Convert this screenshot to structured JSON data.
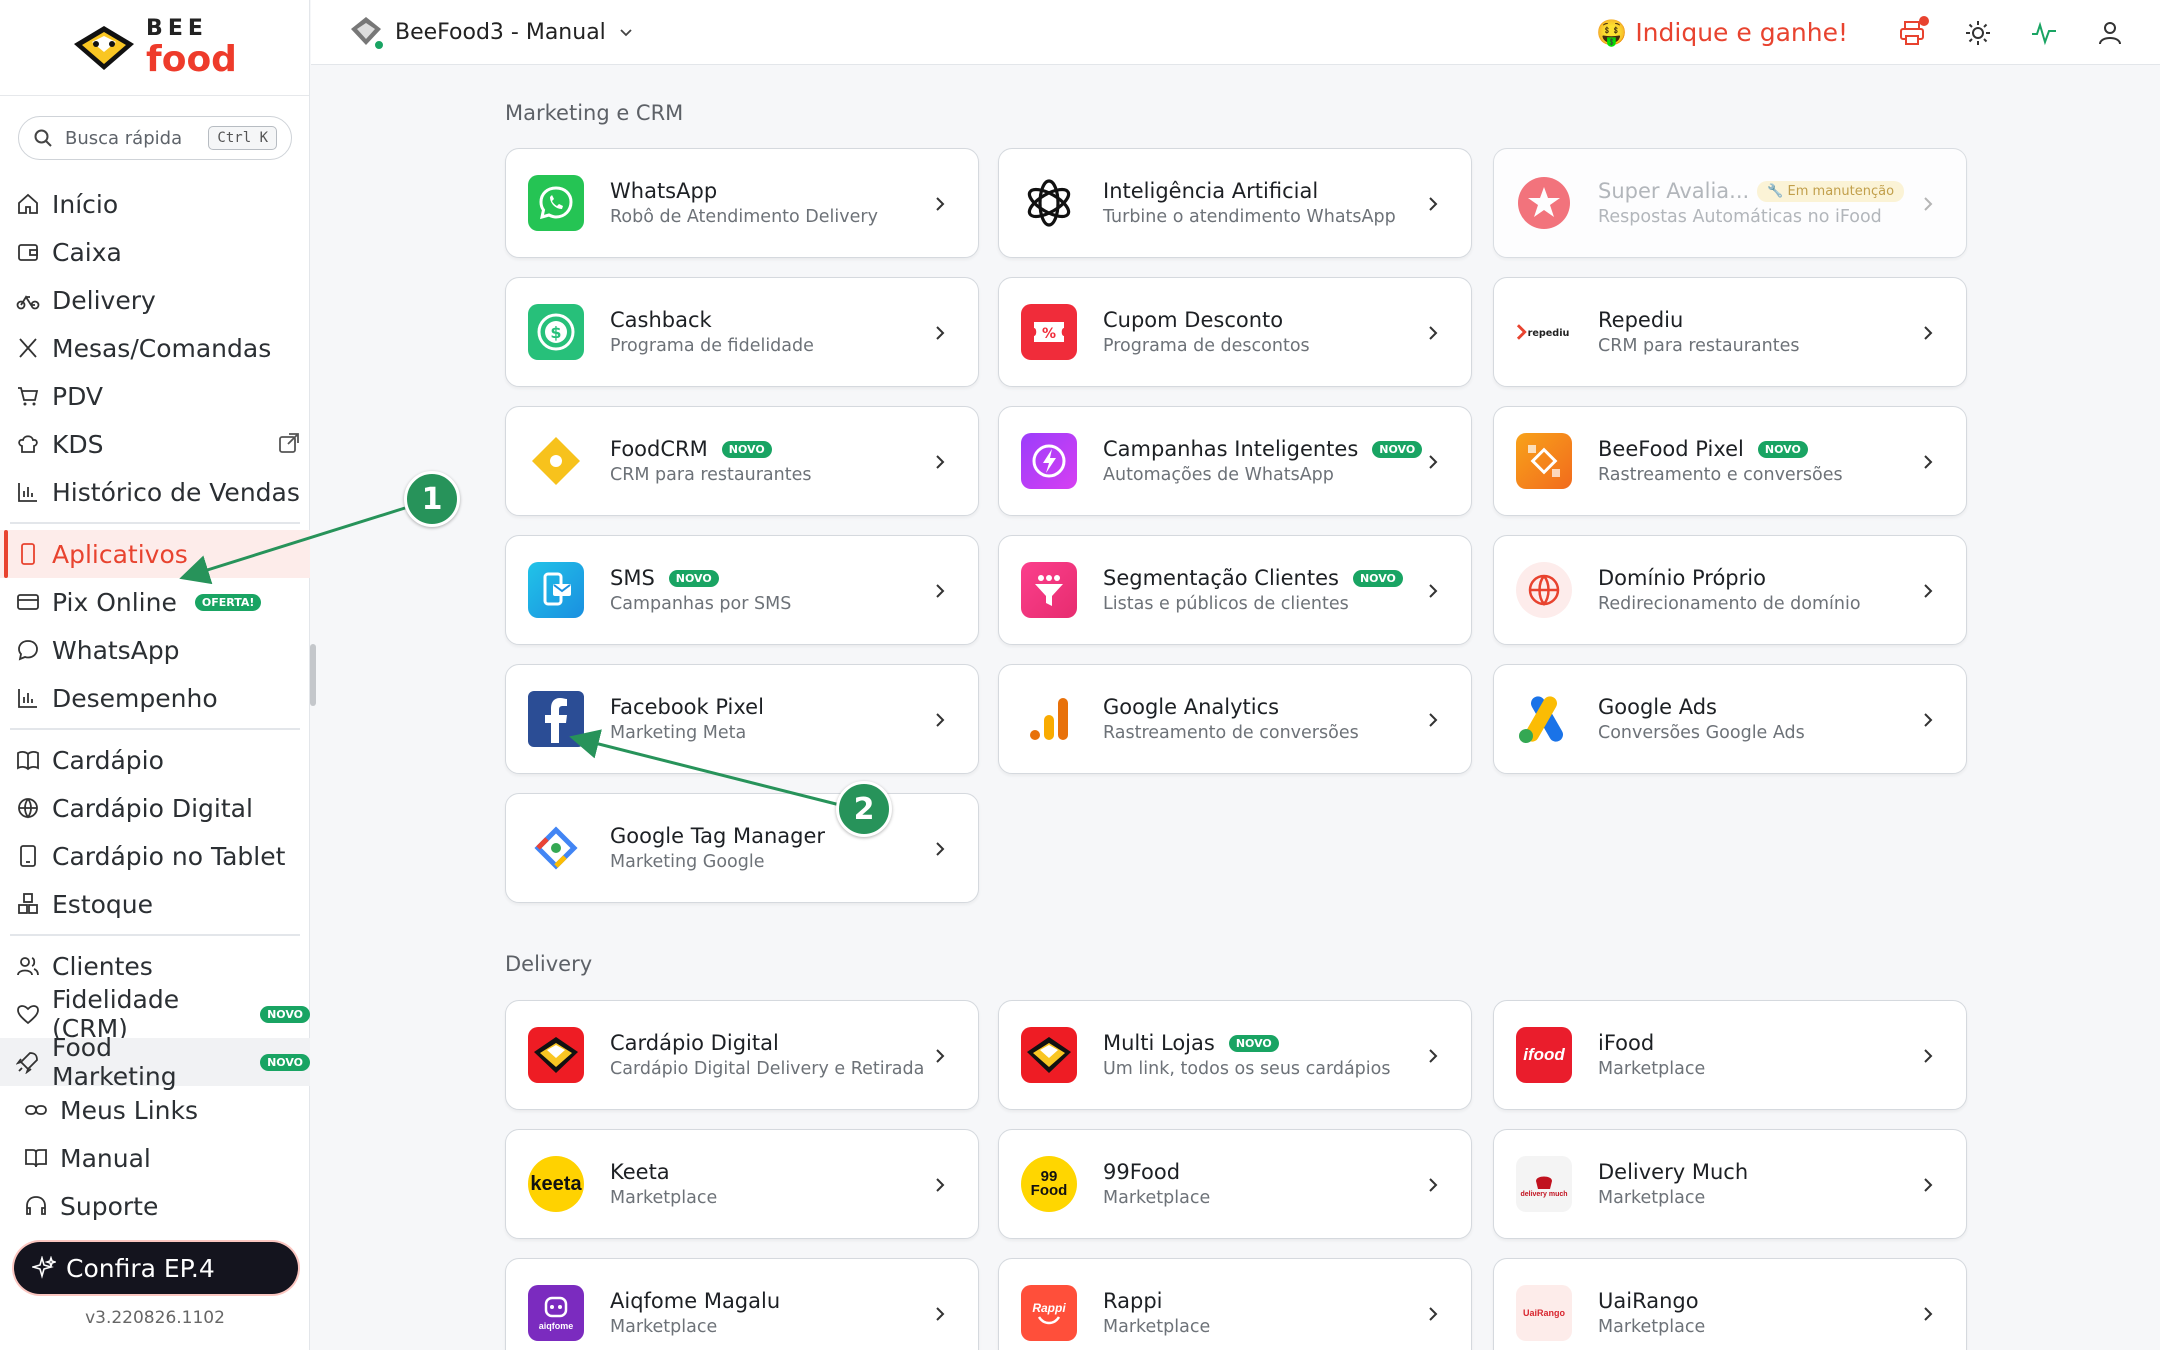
{
  "brand": {
    "top": "BEE",
    "bottom": "food"
  },
  "search": {
    "placeholder": "Busca rápida",
    "shortcut": "Ctrl K"
  },
  "sidebar": {
    "items": [
      {
        "label": "Início",
        "icon": "home-icon"
      },
      {
        "label": "Caixa",
        "icon": "wallet-icon"
      },
      {
        "label": "Delivery",
        "icon": "bike-icon"
      },
      {
        "label": "Mesas/Comandas",
        "icon": "utensils-icon"
      },
      {
        "label": "PDV",
        "icon": "cart-icon"
      },
      {
        "label": "KDS",
        "icon": "chef-hat-icon"
      },
      {
        "label": "Histórico de Vendas",
        "icon": "bar-chart-icon"
      },
      {
        "label": "Aplicativos",
        "icon": "phone-icon"
      },
      {
        "label": "Pix Online",
        "icon": "card-icon",
        "badge": "OFERTA!"
      },
      {
        "label": "WhatsApp",
        "icon": "chat-icon"
      },
      {
        "label": "Desempenho",
        "icon": "stats-icon"
      },
      {
        "label": "Cardápio",
        "icon": "book-icon"
      },
      {
        "label": "Cardápio Digital",
        "icon": "globe-icon"
      },
      {
        "label": "Cardápio no Tablet",
        "icon": "tablet-icon"
      },
      {
        "label": "Estoque",
        "icon": "boxes-icon"
      },
      {
        "label": "Clientes",
        "icon": "users-icon"
      },
      {
        "label": "Fidelidade (CRM)",
        "icon": "heart-icon",
        "badge": "NOVO"
      },
      {
        "label": "Food Marketing",
        "icon": "rocket-icon",
        "badge": "NOVO"
      },
      {
        "label": "Meus Links",
        "icon": "link-icon"
      },
      {
        "label": "Manual",
        "icon": "manual-icon"
      },
      {
        "label": "Suporte",
        "icon": "headset-icon"
      }
    ],
    "cta": "Confira EP.4",
    "version": "v3.220826.1102"
  },
  "header": {
    "store": "BeeFood3 - Manual",
    "refer": "Indique e ganhe!",
    "refer_emoji": "🤑"
  },
  "sections": {
    "marketing": {
      "title": "Marketing e CRM",
      "cards": [
        {
          "title": "WhatsApp",
          "sub": "Robô de Atendimento Delivery"
        },
        {
          "title": "Inteligência Artificial",
          "sub": "Turbine o atendimento WhatsApp"
        },
        {
          "title": "Super Avalia...",
          "sub": "Respostas Automáticas no iFood",
          "badge": "🔧 Em manutenção"
        },
        {
          "title": "Cashback",
          "sub": "Programa de fidelidade"
        },
        {
          "title": "Cupom Desconto",
          "sub": "Programa de descontos"
        },
        {
          "title": "Repediu",
          "sub": "CRM para restaurantes",
          "logo": "repediu"
        },
        {
          "title": "FoodCRM",
          "sub": "CRM para restaurantes",
          "badge": "NOVO"
        },
        {
          "title": "Campanhas Inteligentes",
          "sub": "Automações de WhatsApp",
          "badge": "NOVO"
        },
        {
          "title": "BeeFood Pixel",
          "sub": "Rastreamento e conversões",
          "badge": "NOVO"
        },
        {
          "title": "SMS",
          "sub": "Campanhas por SMS",
          "badge": "NOVO"
        },
        {
          "title": "Segmentação Clientes",
          "sub": "Listas e públicos de clientes",
          "badge": "NOVO"
        },
        {
          "title": "Domínio Próprio",
          "sub": "Redirecionamento de domínio"
        },
        {
          "title": "Facebook Pixel",
          "sub": "Marketing Meta"
        },
        {
          "title": "Google Analytics",
          "sub": "Rastreamento de conversões"
        },
        {
          "title": "Google Ads",
          "sub": "Conversões Google Ads"
        },
        {
          "title": "Google Tag Manager",
          "sub": "Marketing Google"
        }
      ]
    },
    "delivery": {
      "title": "Delivery",
      "cards": [
        {
          "title": "Cardápio Digital",
          "sub": "Cardápio Digital Delivery e Retirada"
        },
        {
          "title": "Multi Lojas",
          "sub": "Um link, todos os seus cardápios",
          "badge": "NOVO"
        },
        {
          "title": "iFood",
          "sub": "Marketplace",
          "logo": "ifood"
        },
        {
          "title": "Keeta",
          "sub": "Marketplace",
          "logo": "keeta"
        },
        {
          "title": "99Food",
          "sub": "Marketplace",
          "logo": "99\nFood"
        },
        {
          "title": "Delivery Much",
          "sub": "Marketplace",
          "logo": "delivery much"
        },
        {
          "title": "Aiqfome Magalu",
          "sub": "Marketplace",
          "logo": "aiqfome"
        },
        {
          "title": "Rappi",
          "sub": "Marketplace",
          "logo": "Rappi"
        },
        {
          "title": "UaiRango",
          "sub": "Marketplace",
          "logo": "UaiRango"
        }
      ]
    }
  },
  "annotations": [
    "1",
    "2"
  ],
  "colors": {
    "accent": "#e8432f",
    "green": "#19a463",
    "annotation": "#27935a"
  }
}
